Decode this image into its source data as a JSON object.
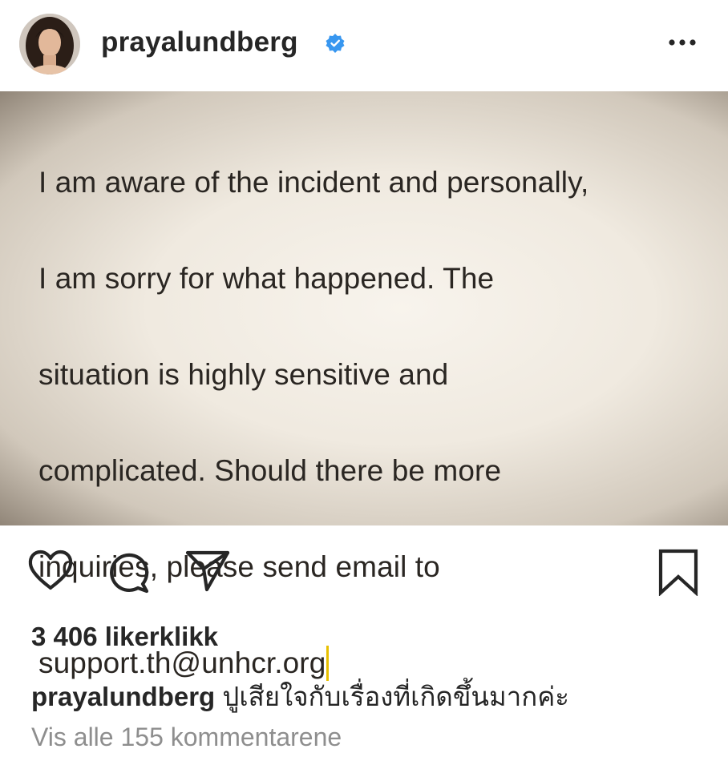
{
  "header": {
    "username": "prayalundberg",
    "verified": true,
    "more_icon": "ellipsis-icon"
  },
  "post": {
    "text_lines": [
      "I am aware of the incident and personally,",
      "I am sorry for what happened. The",
      "situation is highly sensitive and",
      "complicated. Should there be more",
      "inquiries, please send email to",
      "support.th@unhcr.org"
    ],
    "cursor_color": "#e8c000"
  },
  "actions": {
    "icons": [
      "heart-icon",
      "comment-icon",
      "share-icon",
      "bookmark-icon"
    ]
  },
  "likes": "3 406 likerklikk",
  "caption": {
    "user": "prayalundberg",
    "text": "ปูเสียใจกับเรื่องที่เกิดขึ้นมากค่ะ"
  },
  "comments_link": "Vis alle 155 kommentarene",
  "colors": {
    "text": "#262626",
    "muted": "#8e8e8e",
    "verified_blue": "#3897f0"
  }
}
